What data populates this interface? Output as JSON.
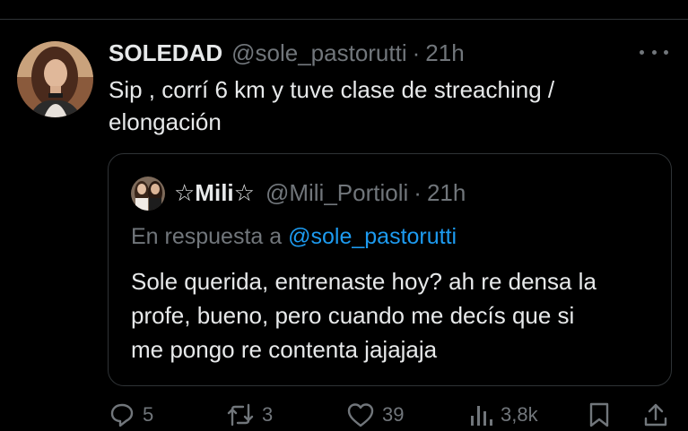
{
  "tweet": {
    "author_name": "SOLEDAD",
    "handle": "@sole_pastorutti",
    "separator": "·",
    "time": "21h",
    "text_lines": [
      "Sip , corrí 6 km y  tuve clase de streaching /",
      "elongación"
    ]
  },
  "quoted": {
    "author_name": "☆Mili☆",
    "handle": "@Mili_Portioli",
    "separator": "·",
    "time": "21h",
    "reply_prefix": "En respuesta a ",
    "reply_mention": "@sole_pastorutti",
    "text_lines": [
      "Sole querida, entrenaste hoy? ah re densa la",
      "profe, bueno, pero cuando me decís que si",
      "me pongo re contenta jajajaja"
    ]
  },
  "actions": {
    "replies": "5",
    "retweets": "3",
    "likes": "39",
    "views": "3,8k"
  },
  "icons": {
    "reply": "reply-icon",
    "retweet": "retweet-icon",
    "like": "heart-icon",
    "views": "views-icon",
    "bookmark": "bookmark-icon",
    "share": "share-icon",
    "more": "more-icon"
  },
  "colors": {
    "background": "#000000",
    "text": "#e7e9ea",
    "muted": "#71767b",
    "link": "#1d9bf0",
    "border": "#2f3336"
  }
}
